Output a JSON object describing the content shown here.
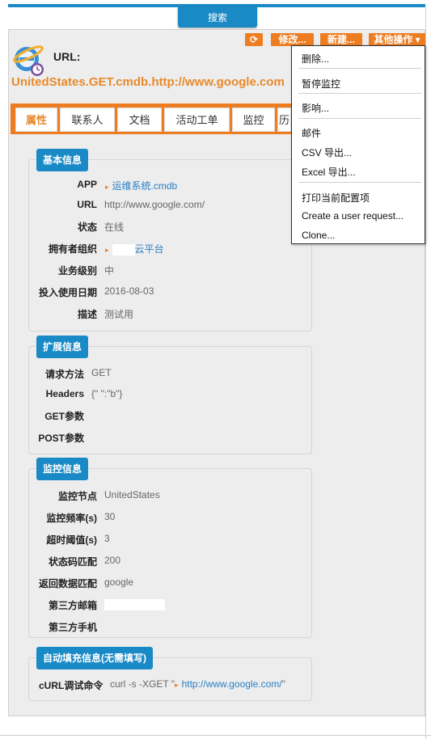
{
  "search_tab": "搜索",
  "header": {
    "url_label": "URL:",
    "ci_name": "UnitedStates.GET.cmdb.http://www.google.com"
  },
  "toolbar": {
    "refresh": "⟳",
    "edit": "修改...",
    "new": "新建...",
    "more": "其他操作 ▾"
  },
  "tabs": [
    "属性",
    "联系人",
    "文档",
    "活动工单",
    "监控",
    "历"
  ],
  "panels": {
    "basic": {
      "title": "基本信息",
      "rows": [
        {
          "label": "APP",
          "value": "运维系统.cmdb"
        },
        {
          "label": "URL",
          "value": "http://www.google.com/"
        },
        {
          "label": "状态",
          "value": "在线"
        },
        {
          "label": "拥有者组织",
          "value": "云平台"
        },
        {
          "label": "业务级别",
          "value": "中"
        },
        {
          "label": "投入使用日期",
          "value": "2016-08-03"
        },
        {
          "label": "描述",
          "value": "测试用"
        }
      ]
    },
    "ext": {
      "title": "扩展信息",
      "rows": [
        {
          "label": "请求方法",
          "value": "GET"
        },
        {
          "label": "Headers",
          "value": "{\" \":\"b\"}"
        },
        {
          "label": "GET参数",
          "value": ""
        },
        {
          "label": "POST参数",
          "value": ""
        }
      ]
    },
    "monitor": {
      "title": "监控信息",
      "rows": [
        {
          "label": "监控节点",
          "value": "UnitedStates"
        },
        {
          "label": "监控频率(s)",
          "value": "30"
        },
        {
          "label": "超时阈值(s)",
          "value": "3"
        },
        {
          "label": "状态码匹配",
          "value": "200"
        },
        {
          "label": "返回数据匹配",
          "value": "google"
        },
        {
          "label": "第三方邮箱",
          "value": ""
        },
        {
          "label": "第三方手机",
          "value": ""
        }
      ]
    },
    "auto": {
      "title": "自动填充信息(无需填写)",
      "rows": [
        {
          "label": "cURL调试命令",
          "prefix": "curl -s -XGET \"",
          "link": "http://www.google.com/",
          "suffix": "\""
        }
      ]
    }
  },
  "dropdown": {
    "items": [
      "删除...",
      "暂停监控",
      "影响...",
      "邮件",
      "CSV 导出...",
      "Excel 导出...",
      "打印当前配置项",
      "Create a user request...",
      "Clone..."
    ]
  },
  "colors": {
    "accent": "#ee7d22",
    "primary": "#1a8ac6",
    "link": "#2a7fc4"
  }
}
